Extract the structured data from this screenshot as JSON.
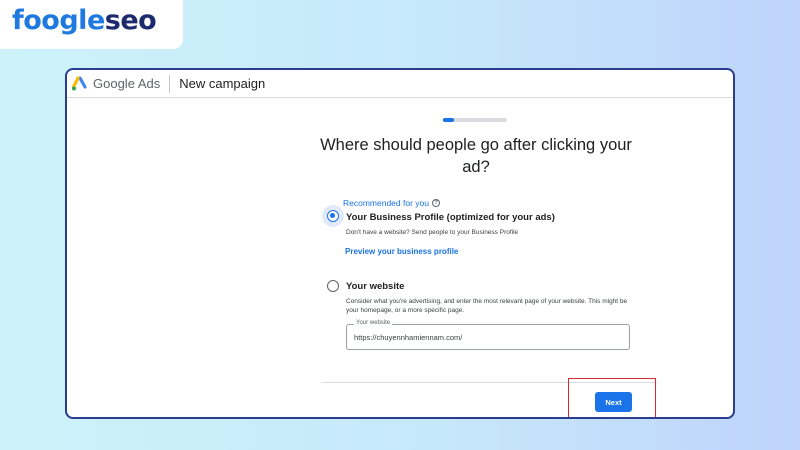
{
  "brand_logo": {
    "part1": "foo",
    "part2": "gle",
    "part3": "seo"
  },
  "app": {
    "brand_name": "Google Ads",
    "breadcrumb": "New campaign"
  },
  "progress": {
    "fraction": 0.17
  },
  "main": {
    "question": "Where should people go after clicking your ad?",
    "recommended_label": "Recommended for you",
    "option_profile": {
      "title": "Your Business Profile (optimized for your ads)",
      "description": "Don't have a website? Send people to your Business Profile",
      "link": "Preview your business profile",
      "selected": true
    },
    "option_website": {
      "title": "Your website",
      "description": "Consider what you're advertising, and enter the most relevant page of your website. This might be your homepage, or a more specific page.",
      "field_label": "Your website",
      "field_value": "https://chuyennhamiennam.com/",
      "selected": false
    }
  },
  "footer": {
    "next_label": "Next"
  },
  "colors": {
    "accent": "#1a73e8",
    "highlight": "#d9272e",
    "window_border": "#2a3d8f"
  }
}
